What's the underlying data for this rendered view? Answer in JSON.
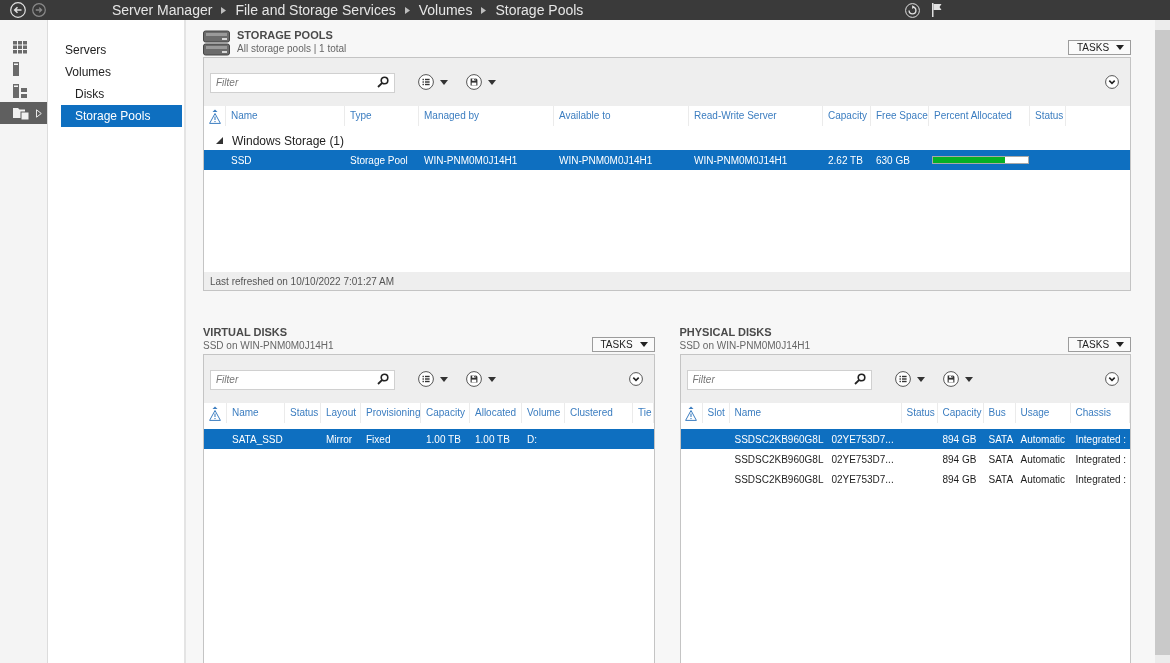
{
  "title_bar": {
    "breadcrumb": [
      "Server Manager",
      "File and Storage Services",
      "Volumes",
      "Storage Pools"
    ]
  },
  "rail": [
    {
      "kind": "dashboard",
      "selected": false
    },
    {
      "kind": "server",
      "selected": false
    },
    {
      "kind": "servers",
      "selected": false
    },
    {
      "kind": "storage",
      "selected": true
    }
  ],
  "nav": {
    "items": [
      {
        "label": "Servers",
        "selected": false
      },
      {
        "label": "Volumes",
        "selected": false,
        "children": [
          {
            "label": "Disks",
            "selected": false
          },
          {
            "label": "Storage Pools",
            "selected": true
          }
        ]
      }
    ]
  },
  "storage_pools": {
    "title": "STORAGE POOLS",
    "subtitle": "All storage pools | 1 total",
    "tasks": "TASKS",
    "filter": {
      "placeholder": "Filter"
    },
    "columns": [
      "Name",
      "Type",
      "Managed by",
      "Available to",
      "Read-Write Server",
      "Capacity",
      "Free Space",
      "Percent Allocated",
      "Status"
    ],
    "groups": [
      {
        "label": "Windows Storage (1)",
        "expanded": true,
        "rows": [
          {
            "selected": true,
            "name": "SSD",
            "type": "Storage Pool",
            "managed_by": "WIN-PNM0M0J14H1",
            "available_to": "WIN-PNM0M0J14H1",
            "read_write_server": "WIN-PNM0M0J14H1",
            "capacity": "2.62 TB",
            "free_space": "630 GB",
            "percent_allocated": {
              "level": 0.76
            }
          }
        ]
      }
    ],
    "footer": "Last refreshed on 10/10/2022 7:01:27 AM"
  },
  "virtual_disks": {
    "title": "VIRTUAL DISKS",
    "subtitle": "SSD on WIN-PNM0M0J14H1",
    "tasks": "TASKS",
    "filter": {
      "placeholder": "Filter"
    },
    "columns": [
      "Name",
      "Status",
      "Layout",
      "Provisioning",
      "Capacity",
      "Allocated",
      "Volume",
      "Clustered",
      "Tie"
    ],
    "rows": [
      {
        "selected": true,
        "name": "SATA_SSD",
        "layout": "Mirror",
        "provisioning": "Fixed",
        "capacity": "1.00 TB",
        "allocated": "1.00 TB",
        "volume": "D:"
      }
    ]
  },
  "physical_disks": {
    "title": "PHYSICAL DISKS",
    "subtitle": "SSD on WIN-PNM0M0J14H1",
    "tasks": "TASKS",
    "filter": {
      "placeholder": "Filter"
    },
    "columns": [
      "Slot",
      "Name",
      "Status",
      "Capacity",
      "Bus",
      "Usage",
      "Chassis"
    ],
    "rows": [
      {
        "selected": true,
        "name": "SSDSC2KB960G8L   02YE753D7...",
        "capacity": "894 GB",
        "bus": "SATA",
        "usage": "Automatic",
        "chassis": "Integrated :"
      },
      {
        "selected": false,
        "name": "SSDSC2KB960G8L   02YE753D7...",
        "capacity": "894 GB",
        "bus": "SATA",
        "usage": "Automatic",
        "chassis": "Integrated :"
      },
      {
        "selected": false,
        "name": "SSDSC2KB960G8L   02YE753D7...",
        "capacity": "894 GB",
        "bus": "SATA",
        "usage": "Automatic",
        "chassis": "Integrated :"
      }
    ]
  }
}
